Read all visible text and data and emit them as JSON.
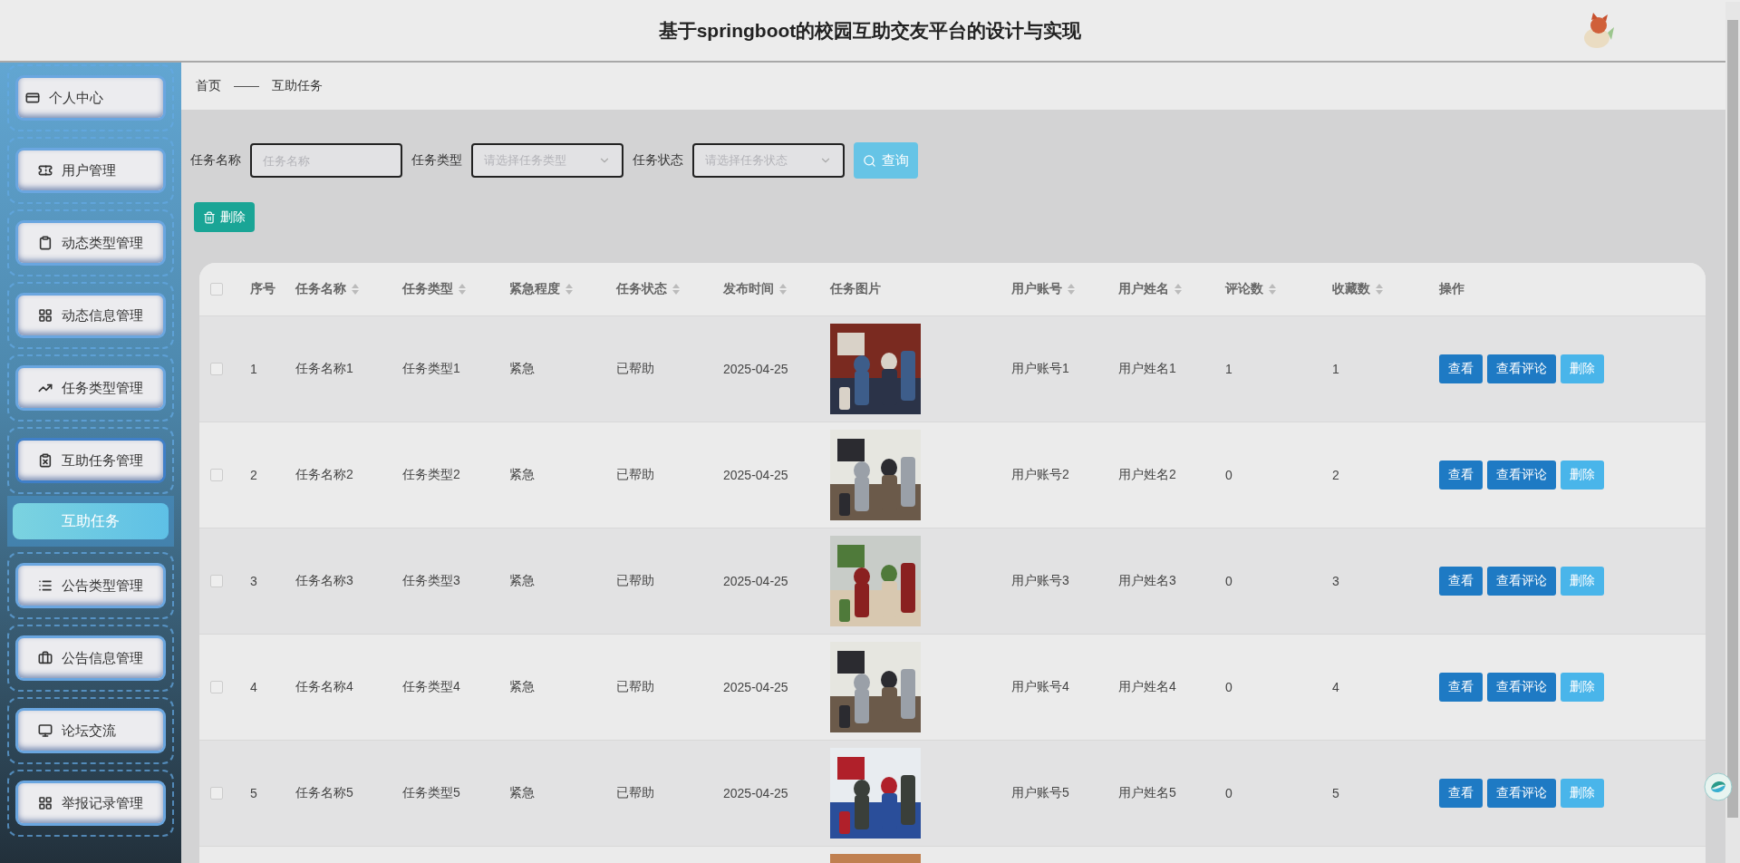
{
  "header": {
    "title": "基于springboot的校园互助交友平台的设计与实现"
  },
  "sidebar": {
    "items": [
      {
        "label": "个人中心",
        "expanded": false
      },
      {
        "label": "用户管理",
        "expanded": false
      },
      {
        "label": "动态类型管理",
        "expanded": false
      },
      {
        "label": "动态信息管理",
        "expanded": false
      },
      {
        "label": "任务类型管理",
        "expanded": false
      },
      {
        "label": "互助任务管理",
        "expanded": true,
        "children": [
          {
            "label": "互助任务",
            "selected": true
          }
        ]
      },
      {
        "label": "公告类型管理",
        "expanded": false
      },
      {
        "label": "公告信息管理",
        "expanded": false
      },
      {
        "label": "论坛交流",
        "expanded": false
      },
      {
        "label": "举报记录管理",
        "expanded": false
      }
    ]
  },
  "breadcrumb": [
    "首页",
    "互助任务"
  ],
  "filters": [
    {
      "label": "任务名称",
      "kind": "input",
      "placeholder": "任务名称"
    },
    {
      "label": "任务类型",
      "kind": "select",
      "placeholder": "请选择任务类型"
    },
    {
      "label": "任务状态",
      "kind": "select",
      "placeholder": "请选择任务状态"
    }
  ],
  "search_button": "查询",
  "delete_button": "删除",
  "table": {
    "all_checked": false,
    "columns": [
      {
        "label": "序号",
        "sortable": false
      },
      {
        "label": "任务名称",
        "sortable": true
      },
      {
        "label": "任务类型",
        "sortable": true
      },
      {
        "label": "紧急程度",
        "sortable": true
      },
      {
        "label": "任务状态",
        "sortable": true
      },
      {
        "label": "发布时间",
        "sortable": true
      },
      {
        "label": "任务图片",
        "sortable": false
      },
      {
        "label": "用户账号",
        "sortable": true
      },
      {
        "label": "用户姓名",
        "sortable": true
      },
      {
        "label": "评论数",
        "sortable": true
      },
      {
        "label": "收藏数",
        "sortable": true
      },
      {
        "label": "操作",
        "sortable": false
      }
    ],
    "rows": [
      {
        "checked": false,
        "cells": [
          "1",
          "任务名称1",
          "任务类型1",
          "紧急",
          "已帮助",
          "2025-04-25",
          {
            "kind": "picture"
          },
          "用户账号1",
          "用户姓名1",
          "1",
          "1"
        ],
        "actions": [
          {
            "label": "查看",
            "kind": "primary"
          },
          {
            "label": "查看评论",
            "kind": "primary"
          },
          {
            "label": "删除",
            "kind": "light"
          }
        ]
      },
      {
        "checked": false,
        "cells": [
          "2",
          "任务名称2",
          "任务类型2",
          "紧急",
          "已帮助",
          "2025-04-25",
          {
            "kind": "picture"
          },
          "用户账号2",
          "用户姓名2",
          "0",
          "2"
        ],
        "actions": [
          {
            "label": "查看",
            "kind": "primary"
          },
          {
            "label": "查看评论",
            "kind": "primary"
          },
          {
            "label": "删除",
            "kind": "light"
          }
        ]
      },
      {
        "checked": false,
        "cells": [
          "3",
          "任务名称3",
          "任务类型3",
          "紧急",
          "已帮助",
          "2025-04-25",
          {
            "kind": "picture"
          },
          "用户账号3",
          "用户姓名3",
          "0",
          "3"
        ],
        "actions": [
          {
            "label": "查看",
            "kind": "primary"
          },
          {
            "label": "查看评论",
            "kind": "primary"
          },
          {
            "label": "删除",
            "kind": "light"
          }
        ]
      },
      {
        "checked": false,
        "cells": [
          "4",
          "任务名称4",
          "任务类型4",
          "紧急",
          "已帮助",
          "2025-04-25",
          {
            "kind": "picture"
          },
          "用户账号4",
          "用户姓名4",
          "0",
          "4"
        ],
        "actions": [
          {
            "label": "查看",
            "kind": "primary"
          },
          {
            "label": "查看评论",
            "kind": "primary"
          },
          {
            "label": "删除",
            "kind": "light"
          }
        ]
      },
      {
        "checked": false,
        "cells": [
          "5",
          "任务名称5",
          "任务类型5",
          "紧急",
          "已帮助",
          "2025-04-25",
          {
            "kind": "picture"
          },
          "用户账号5",
          "用户姓名5",
          "0",
          "5"
        ],
        "actions": [
          {
            "label": "查看",
            "kind": "primary"
          },
          {
            "label": "查看评论",
            "kind": "primary"
          },
          {
            "label": "删除",
            "kind": "light"
          }
        ]
      },
      {
        "cells": [
          {
            "kind": "picture"
          }
        ]
      }
    ]
  }
}
